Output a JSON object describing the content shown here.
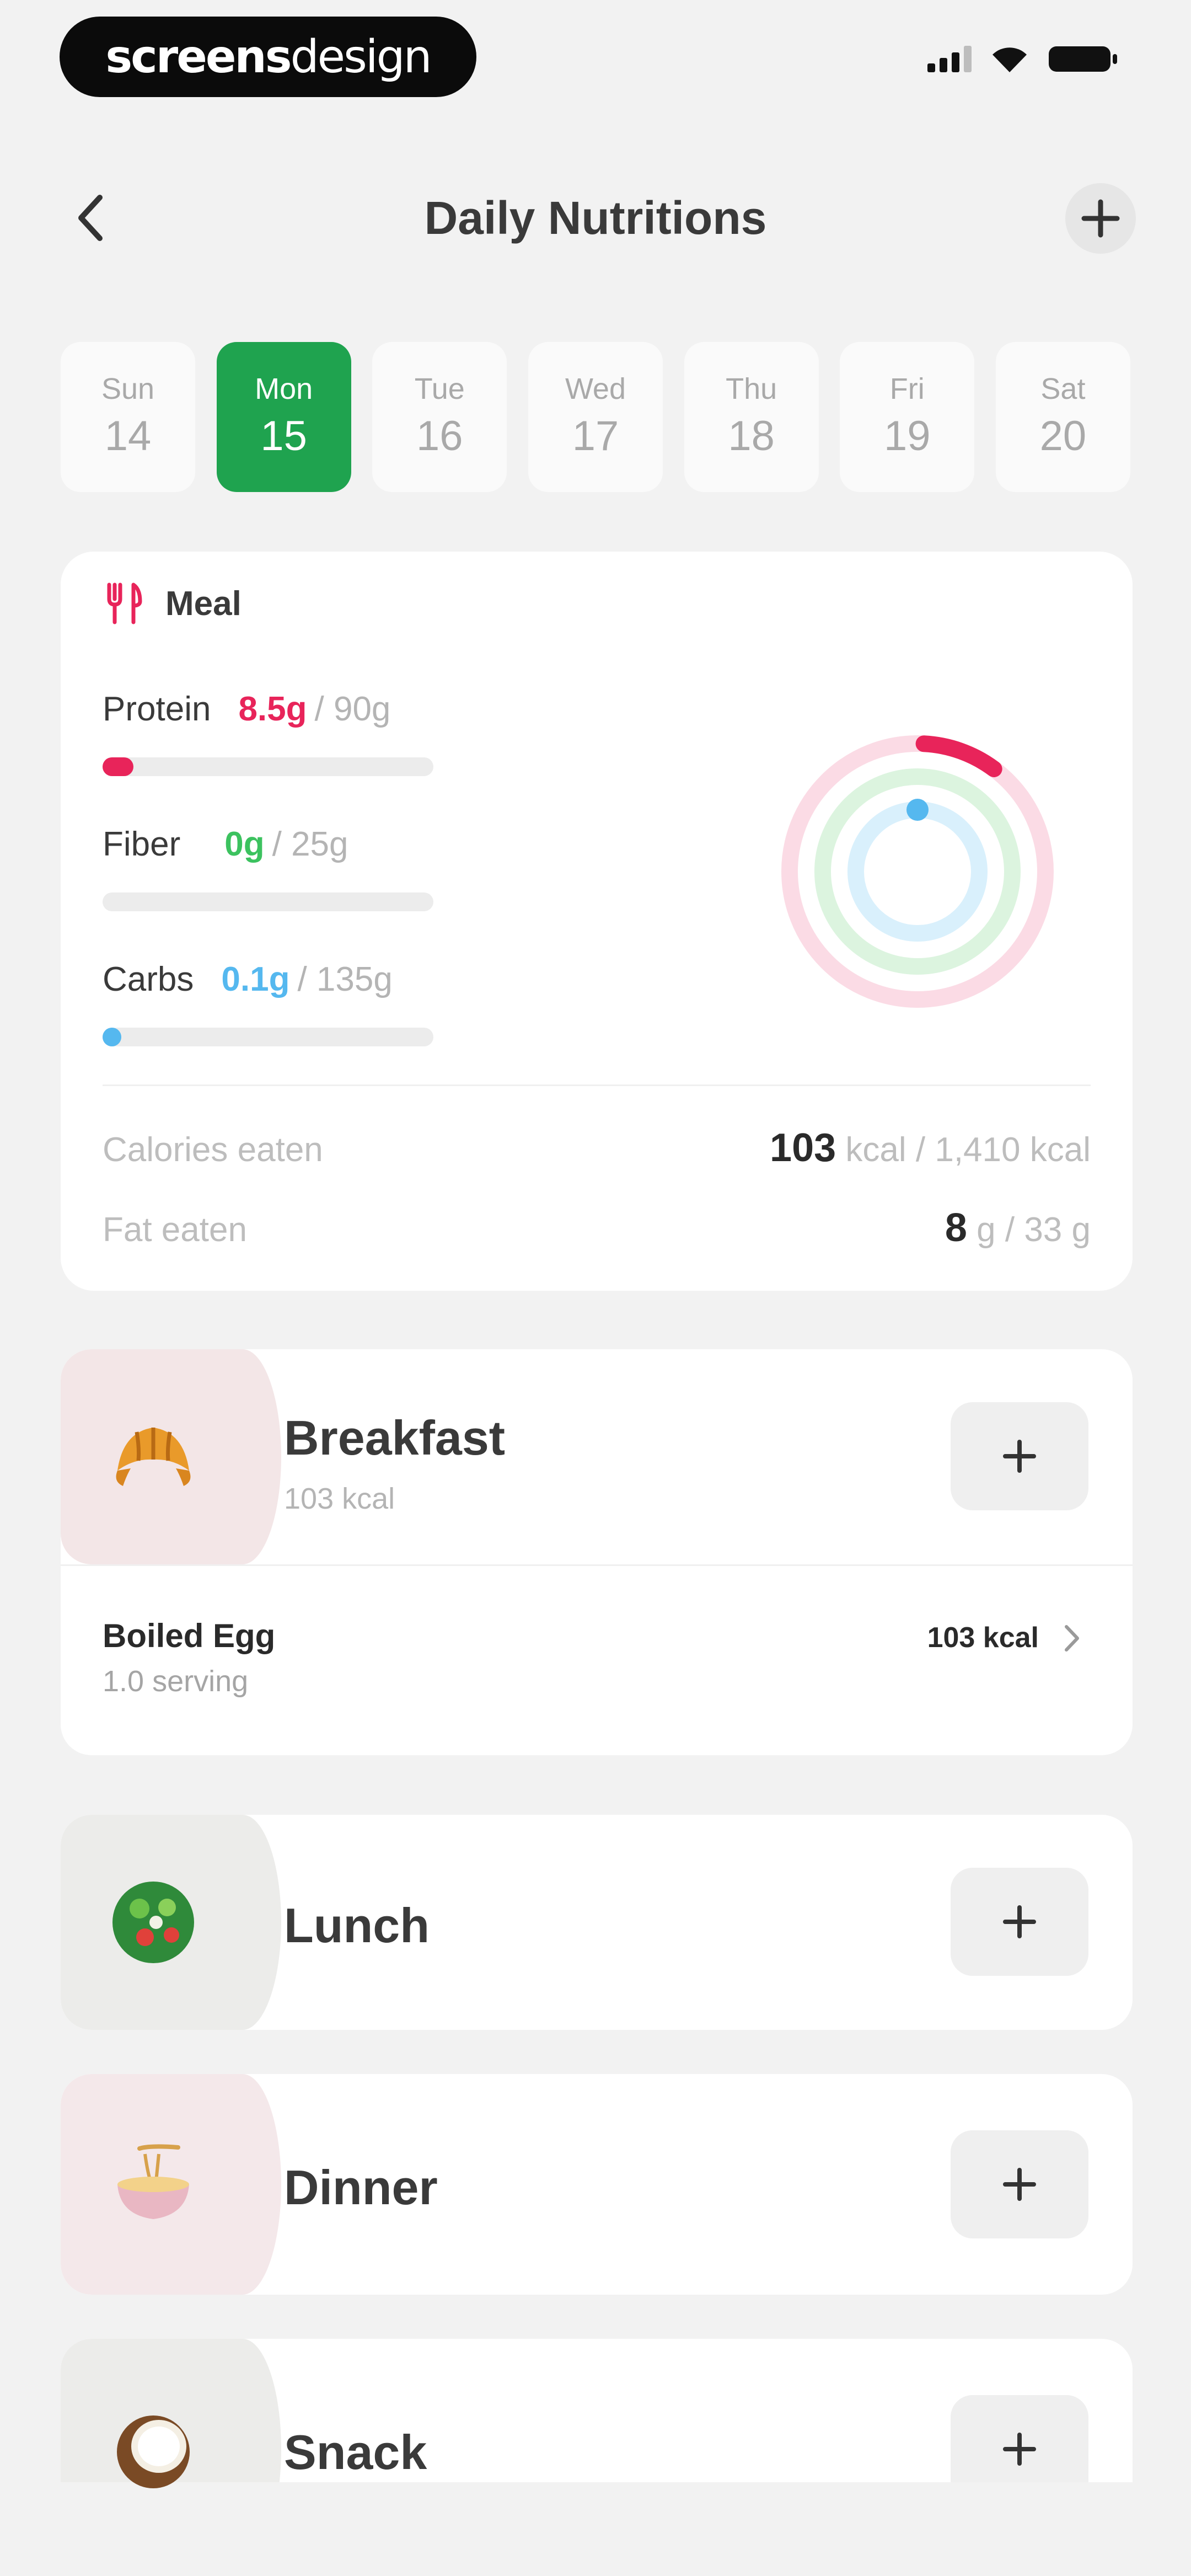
{
  "status_bar": {
    "brand_bold": "screens",
    "brand_light": "design"
  },
  "header": {
    "title": "Daily Nutritions"
  },
  "days": [
    {
      "name": "Sun",
      "num": "14",
      "active": false
    },
    {
      "name": "Mon",
      "num": "15",
      "active": true
    },
    {
      "name": "Tue",
      "num": "16",
      "active": false
    },
    {
      "name": "Wed",
      "num": "17",
      "active": false
    },
    {
      "name": "Thu",
      "num": "18",
      "active": false
    },
    {
      "name": "Fri",
      "num": "19",
      "active": false
    },
    {
      "name": "Sat",
      "num": "20",
      "active": false
    }
  ],
  "summary": {
    "label": "Meal",
    "icon": "fork-knife-icon",
    "macros": [
      {
        "name": "Protein",
        "value": "8.5g",
        "goal": "/ 90g",
        "color": "#e8245a",
        "progress": 0.094
      },
      {
        "name": "Fiber",
        "value": "0g",
        "goal": "/ 25g",
        "color": "#3cc25f",
        "progress": 0.0
      },
      {
        "name": "Carbs",
        "value": "0.1g",
        "goal": "/ 135g",
        "color": "#55b8ef",
        "progress": 0.001
      }
    ],
    "calories": {
      "label": "Calories eaten",
      "value": "103",
      "unit": "kcal / 1,410 kcal"
    },
    "fat": {
      "label": "Fat eaten",
      "value": "8",
      "unit": "g / 33 g"
    }
  },
  "meals": [
    {
      "name": "Breakfast",
      "kcal": "103 kcal",
      "icon": "croissant-icon",
      "thumb_color": "#f3e6e7"
    },
    {
      "name": "Lunch",
      "kcal": "",
      "icon": "salad-icon",
      "thumb_color": "#ececea"
    },
    {
      "name": "Dinner",
      "kcal": "",
      "icon": "noodle-bowl-icon",
      "thumb_color": "#f4e8ea"
    },
    {
      "name": "Snack",
      "kcal": "",
      "icon": "coconut-icon",
      "thumb_color": "#ececea"
    }
  ],
  "breakfast_items": [
    {
      "name": "Boiled Egg",
      "serving": "1.0 serving",
      "kcal": "103 kcal"
    }
  ]
}
